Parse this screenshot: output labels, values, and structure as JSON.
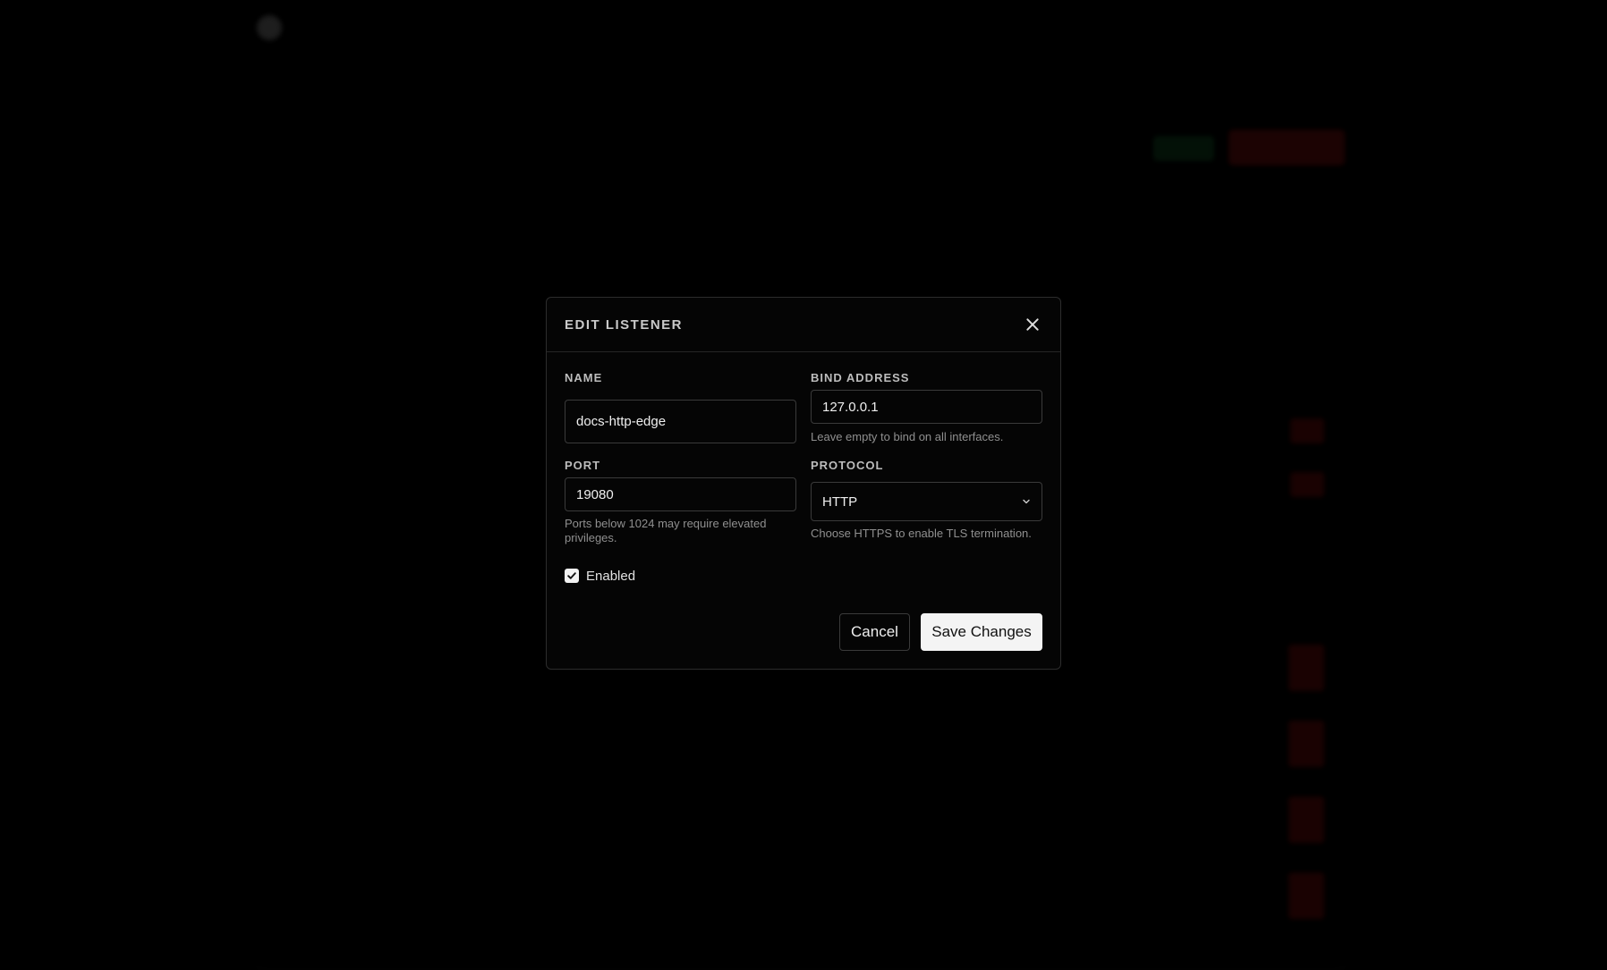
{
  "modal": {
    "title": "EDIT LISTENER",
    "name": {
      "label": "NAME",
      "value": "docs-http-edge"
    },
    "bind_address": {
      "label": "BIND ADDRESS",
      "value": "127.0.0.1",
      "hint": "Leave empty to bind on all interfaces."
    },
    "port": {
      "label": "PORT",
      "value": "19080",
      "hint": "Ports below 1024 may require elevated privileges."
    },
    "protocol": {
      "label": "PROTOCOL",
      "selected": "HTTP",
      "hint": "Choose HTTPS to enable TLS termination."
    },
    "enabled": {
      "label": "Enabled",
      "checked": true
    },
    "cancel_label": "Cancel",
    "save_label": "Save Changes"
  },
  "colors": {
    "modal_bg": "#050505",
    "border": "#3a3a3a",
    "primary_button": "#f4f4f4",
    "danger": "#c21a1a",
    "success": "#1f7a3a"
  }
}
